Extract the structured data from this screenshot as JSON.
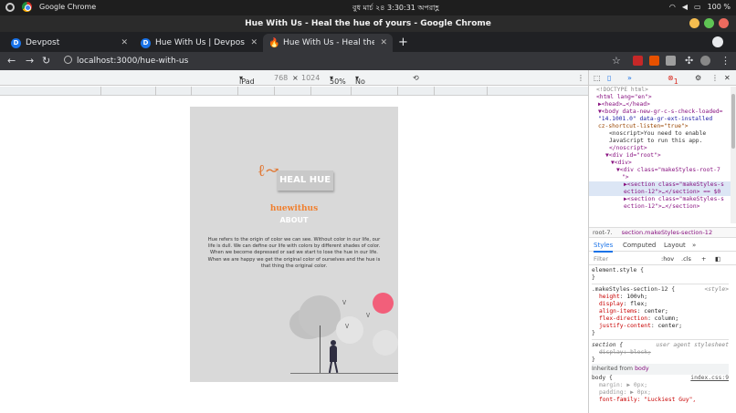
{
  "os": {
    "app_name": "Google Chrome",
    "datetime": "বুধ মার্চ ২৪  3:30:31 অপরাহ্ণ",
    "battery": "100 %"
  },
  "window": {
    "title": "Hue With Us - Heal the hue of yours - Google Chrome"
  },
  "tabs": [
    {
      "label": "Devpost",
      "favicon": "D"
    },
    {
      "label": "Hue With Us | Devpost",
      "favicon": "D"
    },
    {
      "label": "Hue With Us - Heal the hue of yours",
      "favicon": "fire-icon"
    }
  ],
  "address": {
    "url": "localhost:3000/hue-with-us"
  },
  "device_toolbar": {
    "device": "iPad",
    "width": "768",
    "height": "1024",
    "times": "×",
    "zoom": "50%",
    "throttle": "No throttling"
  },
  "page": {
    "heal_label": "HEAL HUE",
    "brand": "huewithus",
    "about": "ABOUT",
    "paragraph": "Hue refers to the origin of color we can see. Without color in our life, our life is dull. We can define our life with colors by different shades of color. When we become depressed or sad we start to lose the hue in our life. When we are happy we get the original color of ourselves and the hue is that thing the original color."
  },
  "devtools": {
    "errors": "1",
    "tree": [
      "<!DOCTYPE html>",
      "<html lang=\"en\">",
      "▶<head>…</head>",
      "▼<body data-new-gr-c-s-check-loaded=",
      "\"14.1001.0\" data-gr-ext-installed",
      "cz-shortcut-listen=\"true\">",
      "<noscript>You need to enable",
      "JavaScript to run this app.",
      "</noscript>",
      "▼<div id=\"root\">",
      "▼<div>",
      "▼<div class=\"makeStyles-root-7",
      "\">",
      "▶<section class=\"makeStyles-s",
      "ection-12\">…</section> == $0",
      "▶<section class=\"makeStyles-s",
      "ection-12\">…</section>"
    ],
    "breadcrumb_root": "root-7.",
    "breadcrumb_selected": "section.makeStyles-section-12",
    "style_tabs": [
      "Styles",
      "Computed",
      "Layout"
    ],
    "filter_placeholder": "Filter",
    "hov": ":hov",
    "cls": ".cls",
    "rules": {
      "element_style": "element.style {",
      "selector": ".makeStyles-section-12 {",
      "source": "<style>",
      "props": [
        {
          "name": "height",
          "value": "100vh;"
        },
        {
          "name": "display",
          "value": "flex;"
        },
        {
          "name": "align-items",
          "value": "center;"
        },
        {
          "name": "flex-direction",
          "value": "column;"
        },
        {
          "name": "justify-content",
          "value": "center;"
        }
      ],
      "ua_selector": "section {",
      "ua_note": "user agent stylesheet",
      "ua_prop": "display: block;",
      "inherited_label": "Inherited from",
      "inherited_tag": "body",
      "body_selector": "body {",
      "body_source": "index.css:9",
      "body_props": [
        "margin: ▶ 0px;",
        "padding: ▶ 0px;",
        "font-family: \"Luckiest Guy\","
      ]
    }
  }
}
